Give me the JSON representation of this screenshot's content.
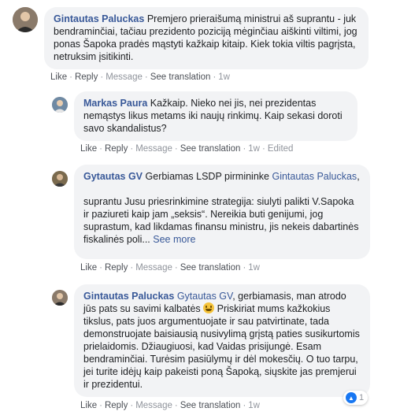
{
  "comments": [
    {
      "author": "Gintautas Paluckas",
      "text": "Premjero prieraišumą ministrui aš suprantu - juk bendraminčiai, tačiau prezidento poziciją mėginčiau aiškinti viltimi, jog ponas Šapoka pradės mąstyti kažkaip kitaip. Kiek tokia viltis pagrįsta, netruksim įsitikinti.",
      "actions": {
        "like": "Like",
        "reply": "Reply",
        "message": "Message",
        "see_translation": "See translation",
        "time": "1w"
      }
    },
    {
      "author": "Markas Paura",
      "text": "Kažkaip. Nieko nei jis, nei prezidentas nemąstys likus metams iki naujų rinkimų. Kaip sekasi doroti savo skandalistus?",
      "actions": {
        "like": "Like",
        "reply": "Reply",
        "message": "Message",
        "see_translation": "See translation",
        "time": "1w",
        "edited": "Edited"
      }
    },
    {
      "author": "Gytautas GV",
      "text_before_mention": "Gerbiamas LSDP pirmininke",
      "mention": "Gintautas Paluckas",
      "mention_suffix": ",",
      "body": "suprantu Jusu priesrinkimine strategija: siulyti palikti V.Sapoka ir paziureti kaip jam „seksis“. Nereikia buti genijumi, jog suprastum, kad likdamas finansu ministru, jis nekeis dabartinės fiskalinės poli...",
      "see_more": "See more",
      "actions": {
        "like": "Like",
        "reply": "Reply",
        "message": "Message",
        "see_translation": "See translation",
        "time": "1w"
      }
    },
    {
      "author": "Gintautas Paluckas",
      "mention": "Gytautas GV",
      "text_a": ", gerbiamasis, man atrodo jūs pats su savimi kalbatės",
      "text_b": "Priskiriat mums kažkokius tikslus, pats juos argumentuojate ir sau patvirtinate, tada demonstruojate baisiausią nusivylimą grįstą paties susikurtomis prielaidomis. Džiaugiuosi, kad Vaidas prisijungė. Esam bendraminčiai. Turėsim pasiūlymų ir dėl mokesčių. O tuo tarpu, jei turite idėjų kaip pakeisti poną Šapoką, siųskite jas premjerui ir prezidentui.",
      "reaction_count": "1",
      "actions": {
        "like": "Like",
        "reply": "Reply",
        "message": "Message",
        "see_translation": "See translation",
        "time": "1w"
      }
    }
  ],
  "colors": {
    "link": "#385898",
    "bubble": "#f2f3f5",
    "meta": "#90949c",
    "like_blue": "#1877f2"
  },
  "icons": {
    "emoji": "grinning-face-icon",
    "reaction": "thumbs-up-icon"
  }
}
